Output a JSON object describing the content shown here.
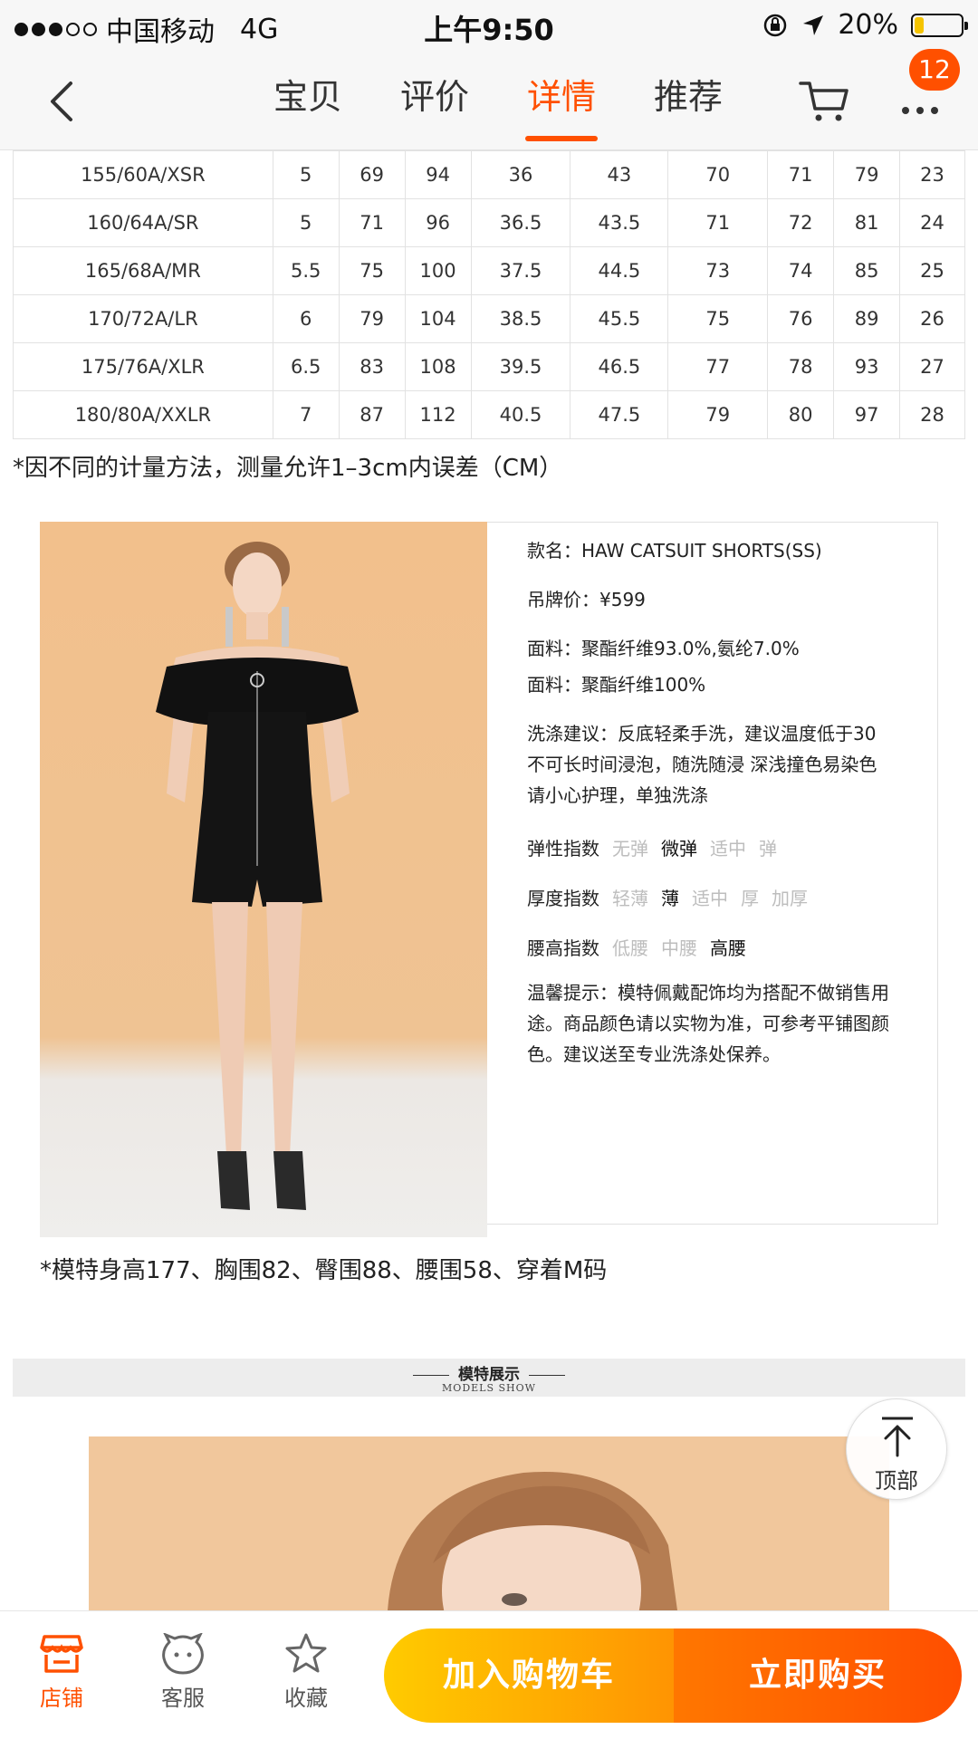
{
  "status_bar": {
    "carrier": "中国移动",
    "network": "4G",
    "time": "上午9:50",
    "battery": "20%",
    "battery_level": 0.2
  },
  "nav": {
    "tabs": [
      {
        "label": "宝贝"
      },
      {
        "label": "评价"
      },
      {
        "label": "详情"
      },
      {
        "label": "推荐"
      }
    ],
    "active_tab": "详情",
    "cart_badge": "12"
  },
  "size_table": {
    "rows": [
      [
        "155/60A/XSR",
        "5",
        "69",
        "94",
        "36",
        "43",
        "70",
        "71",
        "79",
        "23"
      ],
      [
        "160/64A/SR",
        "5",
        "71",
        "96",
        "36.5",
        "43.5",
        "71",
        "72",
        "81",
        "24"
      ],
      [
        "165/68A/MR",
        "5.5",
        "75",
        "100",
        "37.5",
        "44.5",
        "73",
        "74",
        "85",
        "25"
      ],
      [
        "170/72A/LR",
        "6",
        "79",
        "104",
        "38.5",
        "45.5",
        "75",
        "76",
        "89",
        "26"
      ],
      [
        "175/76A/XLR",
        "6.5",
        "83",
        "108",
        "39.5",
        "46.5",
        "77",
        "78",
        "93",
        "27"
      ],
      [
        "180/80A/XXLR",
        "7",
        "87",
        "112",
        "40.5",
        "47.5",
        "79",
        "80",
        "97",
        "28"
      ]
    ],
    "note": "*因不同的计量方法，测量允许1–3cm内误差（CM）"
  },
  "product": {
    "name_line": "款名：HAW CATSUIT SHORTS(SS)",
    "price_line": "吊牌价：¥599",
    "fabric_line_1": "面料：聚酯纤维93.0%,氨纶7.0%",
    "fabric_line_2": "面料：聚酯纤维100%",
    "wash_line_1": "洗涤建议：反底轻柔手洗，建议温度低于30",
    "wash_line_2": "不可长时间浸泡，随洗随浸 深浅撞色易染色",
    "wash_line_3": "请小心护理，单独洗涤",
    "elasticity": {
      "label": "弹性指数",
      "options": [
        "无弹",
        "微弹",
        "适中",
        "弹"
      ],
      "selected": "微弹"
    },
    "thickness": {
      "label": "厚度指数",
      "options": [
        "轻薄",
        "薄",
        "适中",
        "厚",
        "加厚"
      ],
      "selected": "薄"
    },
    "waist": {
      "label": "腰高指数",
      "options": [
        "低腰",
        "中腰",
        "高腰"
      ],
      "selected": "高腰"
    },
    "tip_line_1": "温馨提示：模特佩戴配饰均为搭配不做销售用",
    "tip_line_2": "途。商品颜色请以实物为准，可参考平铺图颜",
    "tip_line_3": "色。建议送至专业洗涤处保养。",
    "model_note": "*模特身高177、胸围82、臀围88、腰围58、穿着M码"
  },
  "models_show": {
    "title": "模特展示",
    "subtitle": "MODELS SHOW"
  },
  "back_to_top": {
    "label": "顶部"
  },
  "bottom_bar": {
    "store": "店铺",
    "service": "客服",
    "favorite": "收藏",
    "add_to_cart": "加入购物车",
    "buy_now": "立即购买"
  },
  "colors": {
    "accent": "#ff5000",
    "add_cart_start": "#ffcb00",
    "add_cart_end": "#ff9402",
    "buy_start": "#ff7700",
    "buy_end": "#ff4e00"
  }
}
